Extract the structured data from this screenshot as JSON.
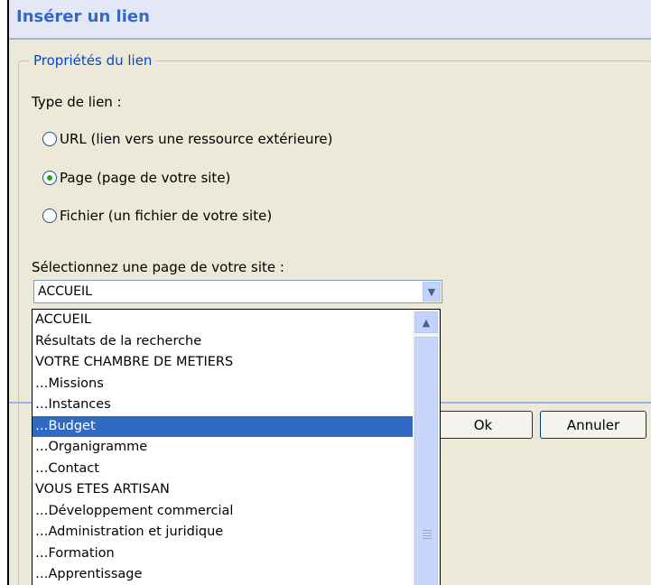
{
  "dialog": {
    "title": "Insérer un lien",
    "group_legend": "Propriétés du lien",
    "link_type_label": "Type de lien :",
    "radios": [
      {
        "label": "URL (lien vers une ressource extérieure)",
        "checked": false
      },
      {
        "label": "Page (page de votre site)",
        "checked": true
      },
      {
        "label": "Fichier (un fichier de votre site)",
        "checked": false
      }
    ],
    "select_label": "Sélectionnez une page de votre site :",
    "select_value": "ACCUEIL",
    "ok_label": "Ok",
    "cancel_label": "Annuler"
  },
  "dropdown": {
    "items": [
      "ACCUEIL",
      "Résultats de la recherche",
      "VOTRE CHAMBRE DE METIERS",
      "…Missions",
      "…Instances",
      "…Budget",
      "…Organigramme",
      "…Contact",
      "VOUS ETES ARTISAN",
      "…Développement commercial",
      "…Administration et juridique",
      "…Formation",
      "…Apprentissage"
    ],
    "selected_index": 5
  },
  "icons": {
    "select_arrow": "chevron-down-icon",
    "scroll_up": "chevron-up-icon",
    "scroll_grip": "grip-icon"
  },
  "colors": {
    "title": "#3468c8",
    "legend": "#0046d5",
    "selection": "#316ac5",
    "radio_dot": "#24a12a"
  }
}
